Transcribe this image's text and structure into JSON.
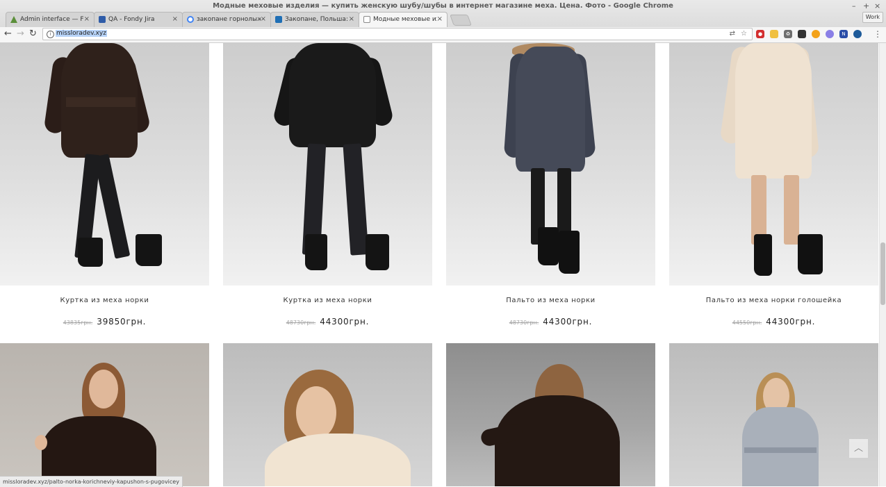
{
  "window": {
    "title": "Модные меховые изделия — купить женскую шубу/шубы в интернет магазине меха. Цена. Фото - Google Chrome",
    "profile_label": "Work"
  },
  "tabs": [
    {
      "label": "Admin interface — FON",
      "icon": "admin-favicon",
      "color": "#5b8f3a"
    },
    {
      "label": "QA - Fondy Jira",
      "icon": "jira-favicon",
      "color": "#2f5ca8"
    },
    {
      "label": "закопане горнолыжн",
      "icon": "google-favicon",
      "color": "#4285f4"
    },
    {
      "label": "Закопане, Польша: тур",
      "icon": "site-favicon",
      "color": "#1f6fb5"
    },
    {
      "label": "Модные меховые изд",
      "icon": "page-favicon",
      "color": "#888888"
    }
  ],
  "toolbar": {
    "url": "missloradev.xyz"
  },
  "products_row1": [
    {
      "name": "Куртка из меха норки",
      "old_price": "43835грн.",
      "price": "39850грн."
    },
    {
      "name": "Куртка из меха норки",
      "old_price": "48730грн.",
      "price": "44300грн."
    },
    {
      "name": "Пальто из меха норки",
      "old_price": "48730грн.",
      "price": "44300грн."
    },
    {
      "name": "Пальто из меха норки голошейка",
      "old_price": "44550грн.",
      "price": "44300грн."
    }
  ],
  "status_url": "missloradev.xyz/palto-norka-korichneviy-kapushon-s-pugovicey",
  "back_to_top_icon": "chevron-up-icon"
}
